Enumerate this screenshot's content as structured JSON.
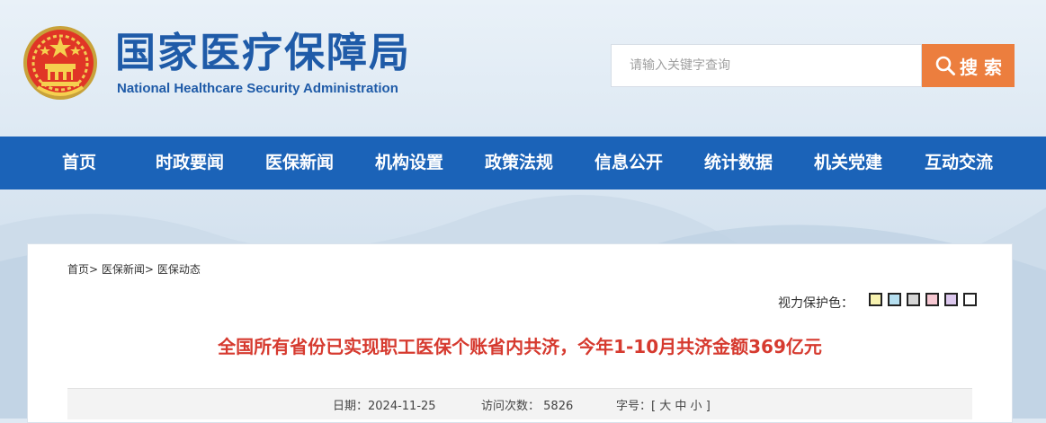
{
  "header": {
    "title_cn": "国家医疗保障局",
    "title_en": "National Healthcare Security Administration"
  },
  "search": {
    "placeholder": "请输入关键字查询",
    "button_label": "搜 索"
  },
  "nav": {
    "items": [
      {
        "label": "首页"
      },
      {
        "label": "时政要闻"
      },
      {
        "label": "医保新闻"
      },
      {
        "label": "机构设置"
      },
      {
        "label": "政策法规"
      },
      {
        "label": "信息公开"
      },
      {
        "label": "统计数据"
      },
      {
        "label": "机关党建"
      },
      {
        "label": "互动交流"
      }
    ]
  },
  "breadcrumb": {
    "items": [
      "首页",
      "医保新闻",
      "医保动态"
    ],
    "separator": ">"
  },
  "eye_protection": {
    "label": "视力保护色：",
    "colors": [
      "#f7f2b0",
      "#b6dff0",
      "#d6d6d6",
      "#f6c8d2",
      "#dcc8ee",
      "#ffffff"
    ]
  },
  "article": {
    "title": "全国所有省份已实现职工医保个账省内共济，今年1-10月共济金额369亿元",
    "date_label": "日期：",
    "date": "2024-11-25",
    "visits_label": "访问次数：",
    "visits": "5826",
    "font_size_label": "字号：",
    "font_size_open": "[",
    "font_size_large": "大",
    "font_size_medium": "中",
    "font_size_small": "小",
    "font_size_close": "]"
  },
  "colors": {
    "nav_bg": "#1b63b8",
    "brand_blue": "#1f5ba8",
    "search_button": "#ec7e3e",
    "title_red": "#d63a2f"
  }
}
